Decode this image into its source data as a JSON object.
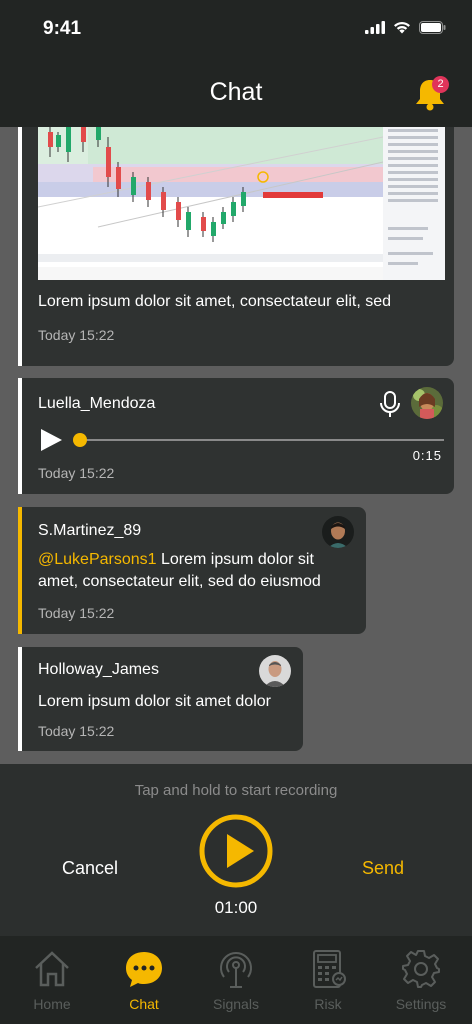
{
  "status_bar": {
    "time": "9:41"
  },
  "header": {
    "title": "Chat",
    "notification_count": "2"
  },
  "messages": [
    {
      "text": "Lorem ipsum dolor sit amet, consectateur elit, sed",
      "time": "Today 15:22"
    },
    {
      "name": "Luella_Mendoza",
      "audio_duration": "0:15",
      "time": "Today 15:22"
    },
    {
      "name": "S.Martinez_89",
      "mention": "@LukeParsons1",
      "text_line1": " Lorem ipsum dolor sit",
      "text_line2": "amet, consectateur elit, sed do eiusmod",
      "time": "Today 15:22"
    },
    {
      "name": "Holloway_James",
      "text": "Lorem ipsum dolor sit amet dolor",
      "time": "Today 15:22"
    }
  ],
  "recording": {
    "hint": "Tap and hold to start recording",
    "cancel_label": "Cancel",
    "send_label": "Send",
    "timer": "01:00"
  },
  "tabs": [
    {
      "label": "Home",
      "icon": "home-icon"
    },
    {
      "label": "Chat",
      "icon": "chat-icon",
      "active": true
    },
    {
      "label": "Signals",
      "icon": "signals-icon"
    },
    {
      "label": "Risk",
      "icon": "calculator-icon"
    },
    {
      "label": "Settings",
      "icon": "gear-icon"
    }
  ],
  "colors": {
    "accent": "#f5b800",
    "background": "#222523",
    "bubble": "#2f3231",
    "badge": "#e0345a"
  }
}
